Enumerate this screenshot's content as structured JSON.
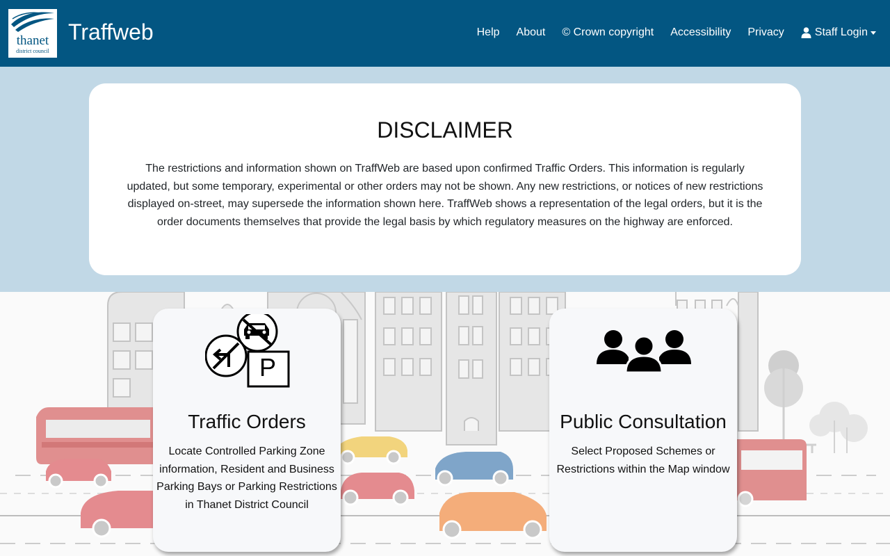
{
  "header": {
    "logo_text": "thanet",
    "logo_subtext": "district council",
    "brand": "Traffweb",
    "nav": [
      {
        "label": "Help"
      },
      {
        "label": "About"
      },
      {
        "label": "© Crown copyright"
      },
      {
        "label": "Accessibility"
      },
      {
        "label": "Privacy"
      },
      {
        "label": "Staff Login",
        "icon": "user-icon",
        "dropdown": true
      }
    ]
  },
  "disclaimer": {
    "title": "DISCLAIMER",
    "text": "The restrictions and information shown on TraffWeb are based upon confirmed Traffic Orders. This information is regularly updated, but some temporary, experimental or other orders may not be shown. Any new restrictions, or notices of new restrictions displayed on-street, may supersede the information shown here. TraffWeb shows a representation of the legal orders, but it is the order documents themselves that provide the legal basis by which regulatory measures on the highway are enforced."
  },
  "cards": [
    {
      "title": "Traffic Orders",
      "description": "Locate Controlled Parking Zone information, Resident and Business Parking Bays or Parking Restrictions in Thanet District Council",
      "icon": "traffic-signs-icon"
    },
    {
      "title": "Public Consultation",
      "description": "Select Proposed Schemes or Restrictions within the Map window",
      "icon": "people-group-icon"
    }
  ],
  "colors": {
    "navbar": "#035682",
    "band": "#c1d8e6",
    "card": "#f7f8fa"
  }
}
